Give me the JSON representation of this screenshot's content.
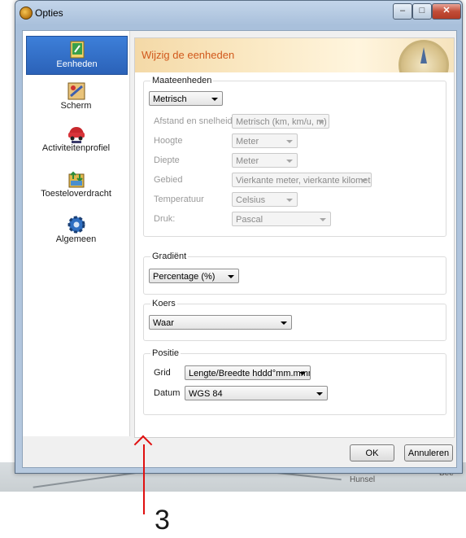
{
  "window": {
    "title": "Opties"
  },
  "sidebar": {
    "items": [
      {
        "label": "Eenheden",
        "active": true,
        "icon": "units-icon"
      },
      {
        "label": "Scherm",
        "active": false,
        "icon": "screen-icon"
      },
      {
        "label": "Activiteitenprofiel",
        "active": false,
        "icon": "car-icon"
      },
      {
        "label": "Toesteloverdracht",
        "active": false,
        "icon": "device-transfer-icon"
      },
      {
        "label": "Algemeen",
        "active": false,
        "icon": "gear-icon"
      }
    ]
  },
  "banner": {
    "title": "Wijzig de eenheden"
  },
  "measurement": {
    "legend": "Maateenheden",
    "system_value": "Metrisch",
    "rows": [
      {
        "label": "Afstand en snelheid:",
        "value": "Metrisch (km, km/u, m)"
      },
      {
        "label": "Hoogte",
        "value": "Meter"
      },
      {
        "label": "Diepte",
        "value": "Meter"
      },
      {
        "label": "Gebied",
        "value": "Vierkante meter, vierkante kilometer"
      },
      {
        "label": "Temperatuur",
        "value": "Celsius"
      },
      {
        "label": "Druk:",
        "value": "Pascal"
      }
    ]
  },
  "gradient": {
    "legend": "Gradiënt",
    "value": "Percentage (%)"
  },
  "heading": {
    "legend": "Koers",
    "value": "Waar"
  },
  "position": {
    "legend": "Positie",
    "grid_label": "Grid",
    "grid_value": "Lengte/Breedte hddd°mm.mmm'",
    "datum_label": "Datum",
    "datum_value": "WGS 84"
  },
  "buttons": {
    "ok": "OK",
    "cancel": "Annuleren"
  },
  "map": {
    "label_1": "Hunsel",
    "label_2": "Bee"
  },
  "annotation": {
    "number": "3"
  },
  "colors": {
    "accent_active": "#2b62b8",
    "banner_title": "#d1591c",
    "annotation": "#e01010"
  }
}
